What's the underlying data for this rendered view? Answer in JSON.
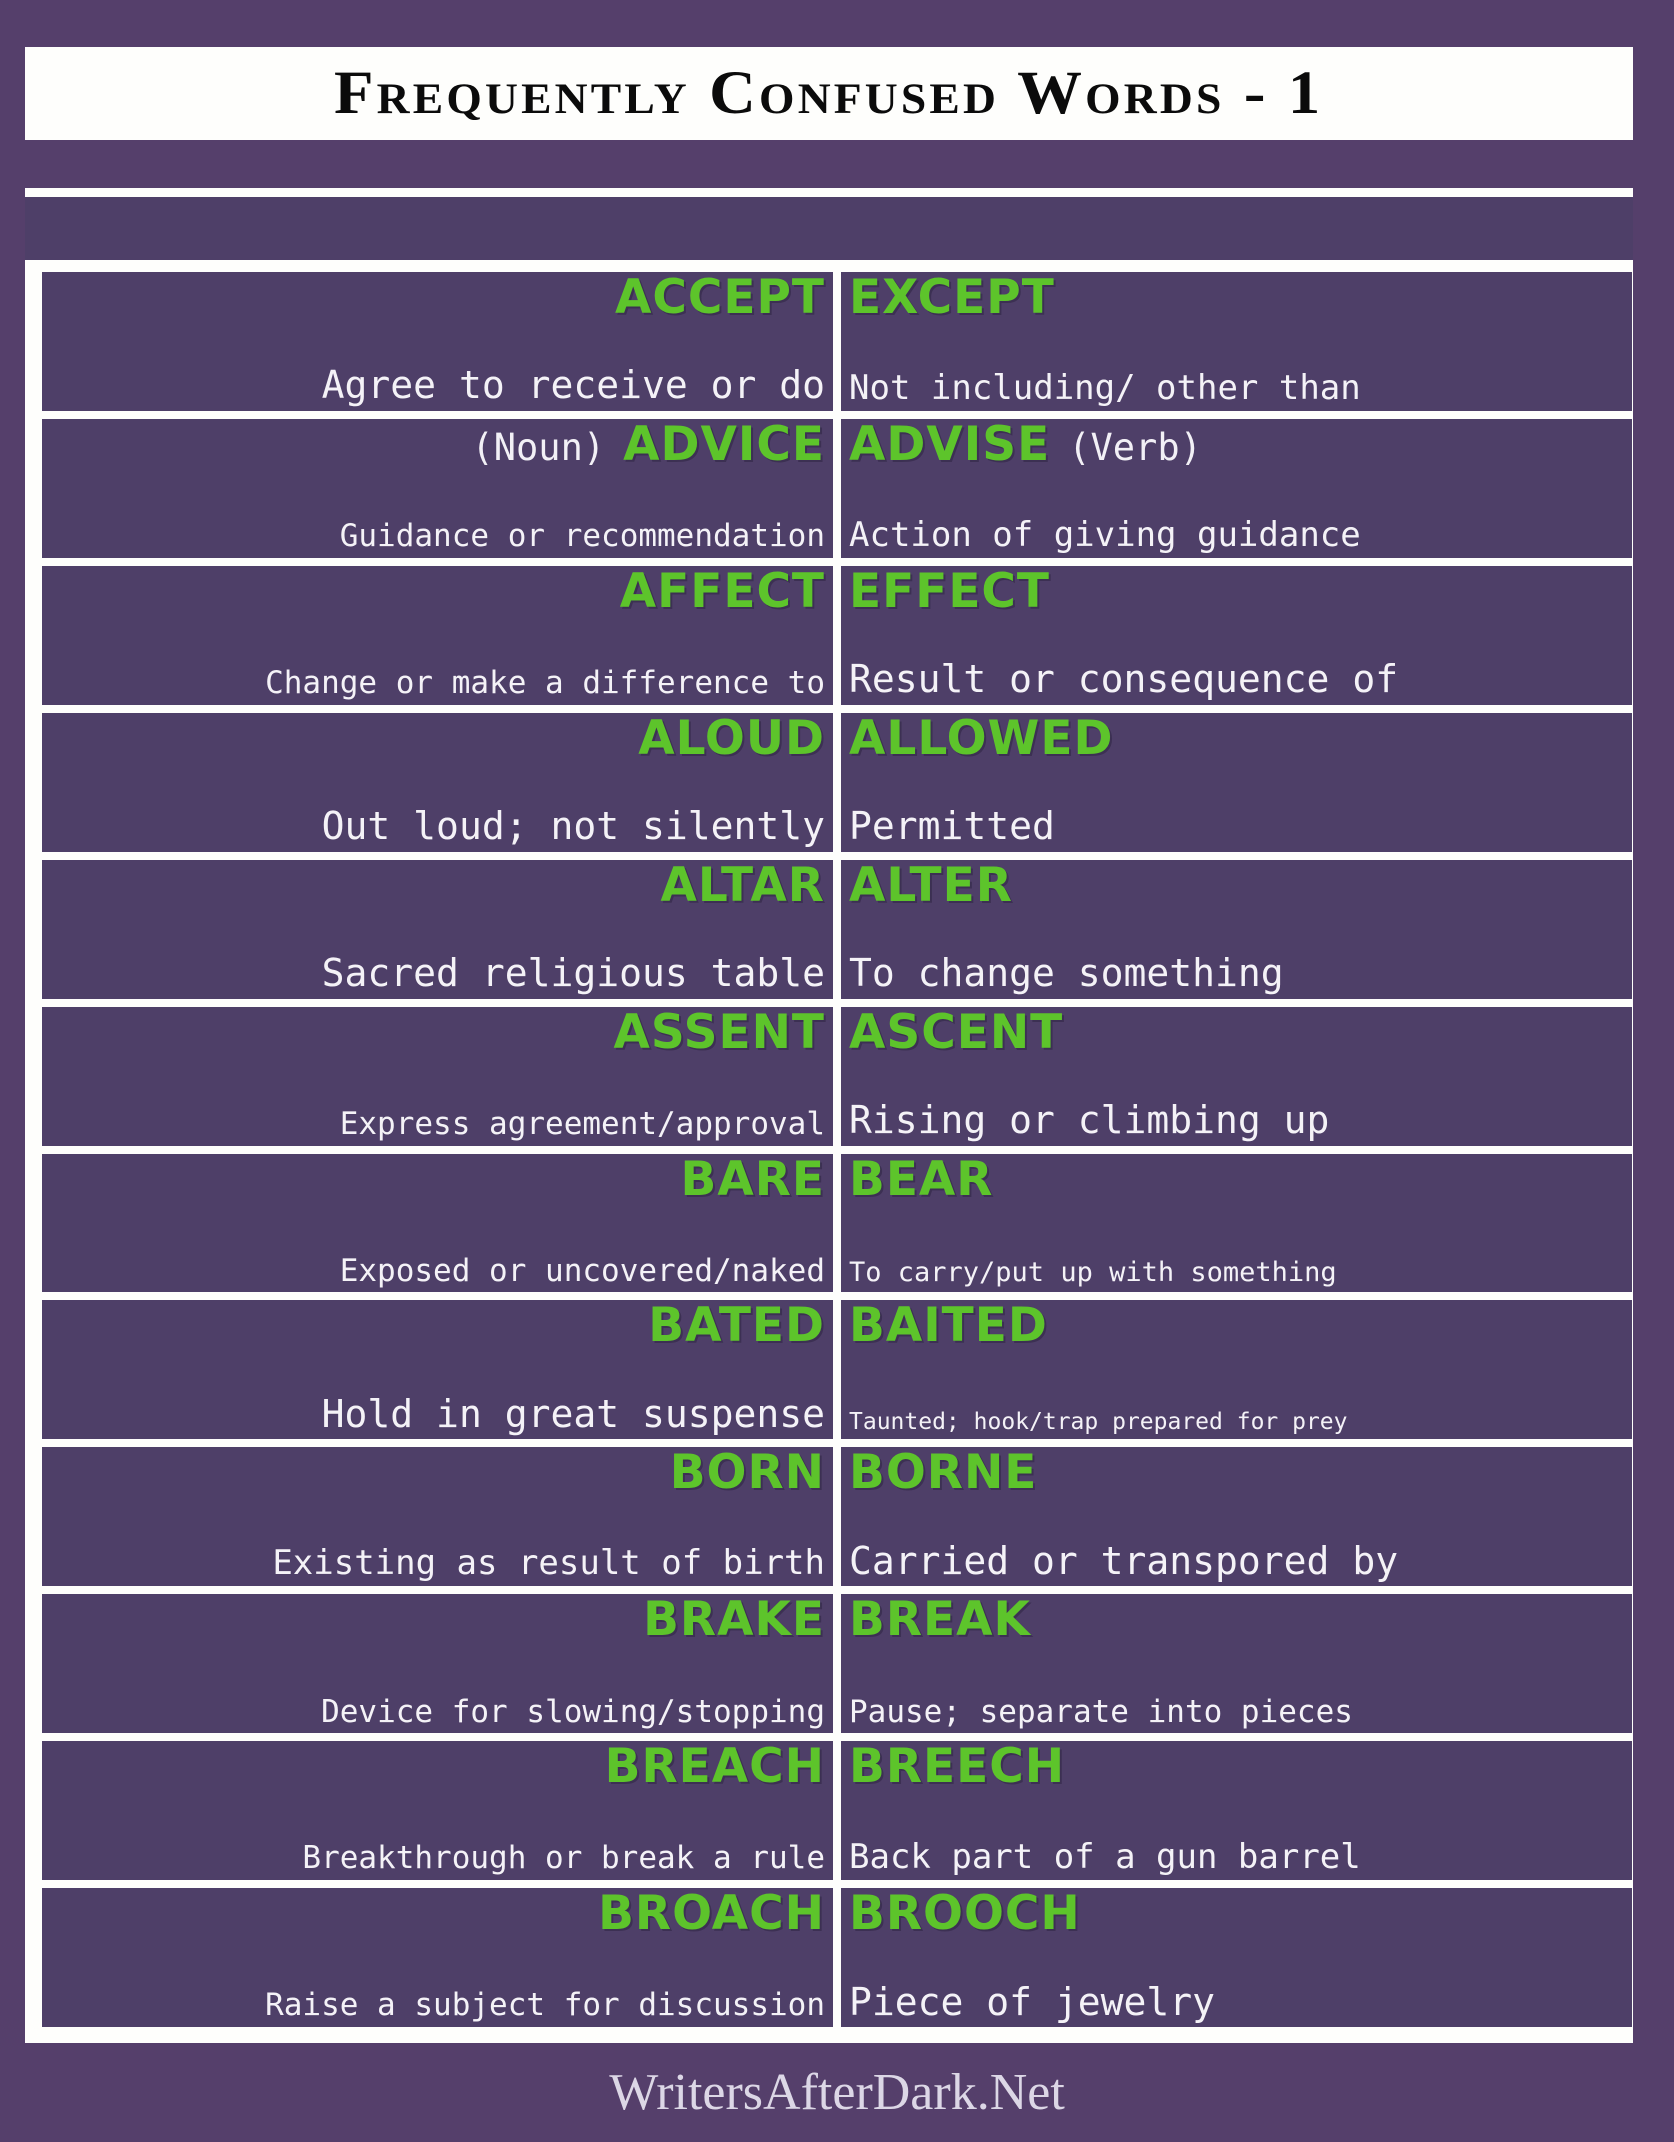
{
  "header": {
    "title": "Frequently Confused Words - 1"
  },
  "footer": {
    "site": "WritersAfterDark.Net"
  },
  "colors": {
    "page_background": "#553F6B",
    "cell_background": "#4E3F68",
    "word_green": "#5DC42B",
    "definition_white": "#F4F2F7",
    "frame_white": "#FEFEFC",
    "title_black": "#0B0B0B"
  },
  "pairs": [
    {
      "left": {
        "word": "ACCEPT",
        "pos": "",
        "pos_side": "",
        "definition": "Agree to receive or do",
        "def_size": "def-xl"
      },
      "right": {
        "word": "EXCEPT",
        "pos": "",
        "pos_side": "",
        "definition": "Not including/ other than",
        "def_size": "def-lg"
      }
    },
    {
      "left": {
        "word": "ADVICE",
        "pos": "(Noun)",
        "pos_side": "before",
        "definition": "Guidance or recommendation",
        "def_size": "def-md"
      },
      "right": {
        "word": "ADVISE",
        "pos": "(Verb)",
        "pos_side": "after",
        "definition": "Action of giving guidance",
        "def_size": "def-lg"
      }
    },
    {
      "left": {
        "word": "AFFECT",
        "pos": "",
        "pos_side": "",
        "definition": "Change or make a difference to",
        "def_size": "def-md"
      },
      "right": {
        "word": "EFFECT",
        "pos": "",
        "pos_side": "",
        "definition": "Result or consequence of",
        "def_size": "def-xl"
      }
    },
    {
      "left": {
        "word": "ALOUD",
        "pos": "",
        "pos_side": "",
        "definition": "Out loud; not silently",
        "def_size": "def-xl"
      },
      "right": {
        "word": "ALLOWED",
        "pos": "",
        "pos_side": "",
        "definition": "Permitted",
        "def_size": "def-xl"
      }
    },
    {
      "left": {
        "word": "ALTAR",
        "pos": "",
        "pos_side": "",
        "definition": "Sacred religious table",
        "def_size": "def-xl"
      },
      "right": {
        "word": "ALTER",
        "pos": "",
        "pos_side": "",
        "definition": "To change something",
        "def_size": "def-xl"
      }
    },
    {
      "left": {
        "word": "ASSENT",
        "pos": "",
        "pos_side": "",
        "definition": "Express agreement/approval",
        "def_size": "def-md"
      },
      "right": {
        "word": "ASCENT",
        "pos": "",
        "pos_side": "",
        "definition": "Rising or climbing up",
        "def_size": "def-xl"
      }
    },
    {
      "left": {
        "word": "BARE",
        "pos": "",
        "pos_side": "",
        "definition": "Exposed or uncovered/naked",
        "def_size": "def-md"
      },
      "right": {
        "word": "BEAR",
        "pos": "",
        "pos_side": "",
        "definition": "To carry/put up with something",
        "def_size": "def-sm"
      }
    },
    {
      "left": {
        "word": "BATED",
        "pos": "",
        "pos_side": "",
        "definition": "Hold in great suspense",
        "def_size": "def-xl"
      },
      "right": {
        "word": "BAITED",
        "pos": "",
        "pos_side": "",
        "definition": "Taunted; hook/trap prepared for prey",
        "def_size": "def-xs"
      }
    },
    {
      "left": {
        "word": "BORN",
        "pos": "",
        "pos_side": "",
        "definition": "Existing as result of birth",
        "def_size": "def-lg"
      },
      "right": {
        "word": "BORNE",
        "pos": "",
        "pos_side": "",
        "definition": "Carried or transpored by",
        "def_size": "def-xl"
      }
    },
    {
      "left": {
        "word": "BRAKE",
        "pos": "",
        "pos_side": "",
        "definition": "Device for slowing/stopping",
        "def_size": "def-md"
      },
      "right": {
        "word": "BREAK",
        "pos": "",
        "pos_side": "",
        "definition": "Pause; separate into pieces",
        "def_size": "def-md"
      }
    },
    {
      "left": {
        "word": "BREACH",
        "pos": "",
        "pos_side": "",
        "definition": "Breakthrough or break a rule",
        "def_size": "def-md"
      },
      "right": {
        "word": "BREECH",
        "pos": "",
        "pos_side": "",
        "definition": "Back part of a gun barrel",
        "def_size": "def-lg"
      }
    },
    {
      "left": {
        "word": "BROACH",
        "pos": "",
        "pos_side": "",
        "definition": "Raise a subject for discussion",
        "def_size": "def-md"
      },
      "right": {
        "word": "BROOCH",
        "pos": "",
        "pos_side": "",
        "definition": "Piece of jewelry",
        "def_size": "def-xl"
      }
    }
  ]
}
